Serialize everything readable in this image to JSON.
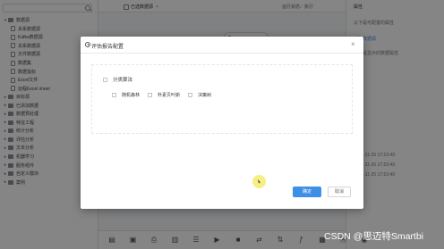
{
  "sidebar": {
    "search_placeholder": "",
    "tree": [
      {
        "label": "数据源",
        "level": 0,
        "expanded": true
      },
      {
        "label": "关系数据源",
        "level": 1
      },
      {
        "label": "Kafka数据源",
        "level": 1
      },
      {
        "label": "关系数据源",
        "level": 1
      },
      {
        "label": "文件数据源",
        "level": 1
      },
      {
        "label": "数据集",
        "level": 1
      },
      {
        "label": "数据指标",
        "level": 1
      },
      {
        "label": "Excel文件",
        "level": 1
      },
      {
        "label": "远程Excel sheet",
        "level": 1
      },
      {
        "label": "目标源",
        "level": 0
      },
      {
        "label": "已添加数据",
        "level": 0
      },
      {
        "label": "数据预处理",
        "level": 0
      },
      {
        "label": "特征工程",
        "level": 0
      },
      {
        "label": "统计分析",
        "level": 0
      },
      {
        "label": "评估分析",
        "level": 0
      },
      {
        "label": "文本分析",
        "level": 0
      },
      {
        "label": "机器学习",
        "level": 0
      },
      {
        "label": "服务组件",
        "level": 0
      },
      {
        "label": "自定义模块",
        "level": 0
      },
      {
        "label": "案例",
        "level": 0
      }
    ]
  },
  "tabbar": {
    "tab_label": "已选数据源",
    "close_glyph": "×",
    "run_status": "运行状态：执行"
  },
  "right_panel": {
    "title": "属性",
    "lines": [
      {
        "text": "以下是可配置的属性",
        "style": "muted"
      },
      {
        "text": "关联数据源",
        "style": "link"
      },
      {
        "text": "以下是显示的数据属性",
        "style": "muted"
      },
      {
        "text": "2021-11-25 17:53:49",
        "style": "muted"
      },
      {
        "text": "2021-11-25 17:53:49",
        "style": "muted"
      },
      {
        "text": "2021-11-25 17:53:49",
        "style": "muted"
      }
    ]
  },
  "dialog": {
    "title": "评估报告配置",
    "close_glyph": "×",
    "group_label": "分类算法",
    "options": [
      "随机森林",
      "朴素贝叶斯",
      "决策树"
    ],
    "ok_label": "确定",
    "cancel_label": "取消"
  },
  "toolbar": {
    "buttons": [
      "doc-icon",
      "save-icon",
      "print-icon",
      "bar-icon",
      "list-icon",
      "play-icon",
      "stop-icon",
      "route-icon",
      "swap-icon",
      "fx-icon",
      "chart-icon",
      "at-icon",
      "eye-icon"
    ]
  },
  "watermark": "CSDN @思迈特Smartbi"
}
